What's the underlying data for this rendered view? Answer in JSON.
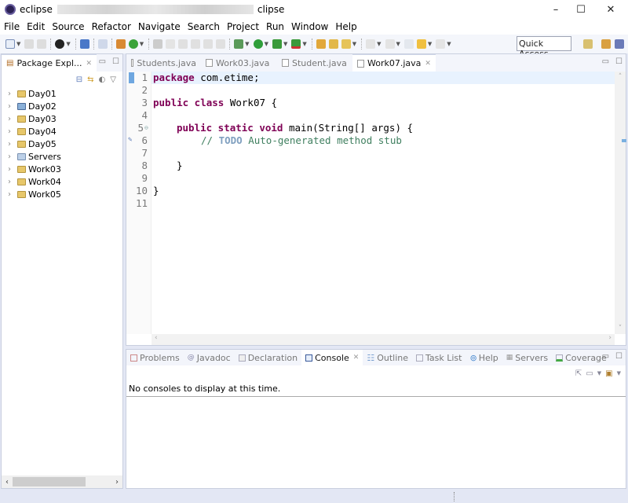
{
  "window": {
    "title_left": "eclipse",
    "title_right": "clipse"
  },
  "menu": [
    "File",
    "Edit",
    "Source",
    "Refactor",
    "Navigate",
    "Search",
    "Project",
    "Run",
    "Window",
    "Help"
  ],
  "toolbar": {
    "quick_access": "Quick Access"
  },
  "package_explorer": {
    "title": "Package Expl...",
    "items": [
      "Day01",
      "Day02",
      "Day03",
      "Day04",
      "Day05",
      "Servers",
      "Work03",
      "Work04",
      "Work05"
    ]
  },
  "editor": {
    "tabs": [
      {
        "label": "Students.java",
        "active": false
      },
      {
        "label": "Work03.java",
        "active": false
      },
      {
        "label": "Student.java",
        "active": false
      },
      {
        "label": "Work07.java",
        "active": true
      }
    ],
    "lines": [
      {
        "n": "1"
      },
      {
        "n": "2"
      },
      {
        "n": "3"
      },
      {
        "n": "4"
      },
      {
        "n": "5"
      },
      {
        "n": "6"
      },
      {
        "n": "7"
      },
      {
        "n": "8"
      },
      {
        "n": "9"
      },
      {
        "n": "10"
      },
      {
        "n": "11"
      }
    ],
    "code": {
      "l1_kw": "package",
      "l1_rest": " com.etime;",
      "l3_kw": "public class",
      "l3_rest": " Work07 {",
      "l5_kw": "public static void",
      "l5_rest": " main(String[] args) {",
      "l6_comment": "// ",
      "l6_todo": "TODO",
      "l6_rest": " Auto-generated method stub",
      "l8": "}",
      "l10": "}"
    }
  },
  "bottom": {
    "tabs": [
      {
        "label": "Problems"
      },
      {
        "label": "Javadoc"
      },
      {
        "label": "Declaration"
      },
      {
        "label": "Console",
        "active": true
      },
      {
        "label": "Outline"
      },
      {
        "label": "Task List"
      },
      {
        "label": "Help"
      },
      {
        "label": "Servers"
      },
      {
        "label": "Coverage"
      }
    ],
    "console_message": "No consoles to display at this time."
  }
}
